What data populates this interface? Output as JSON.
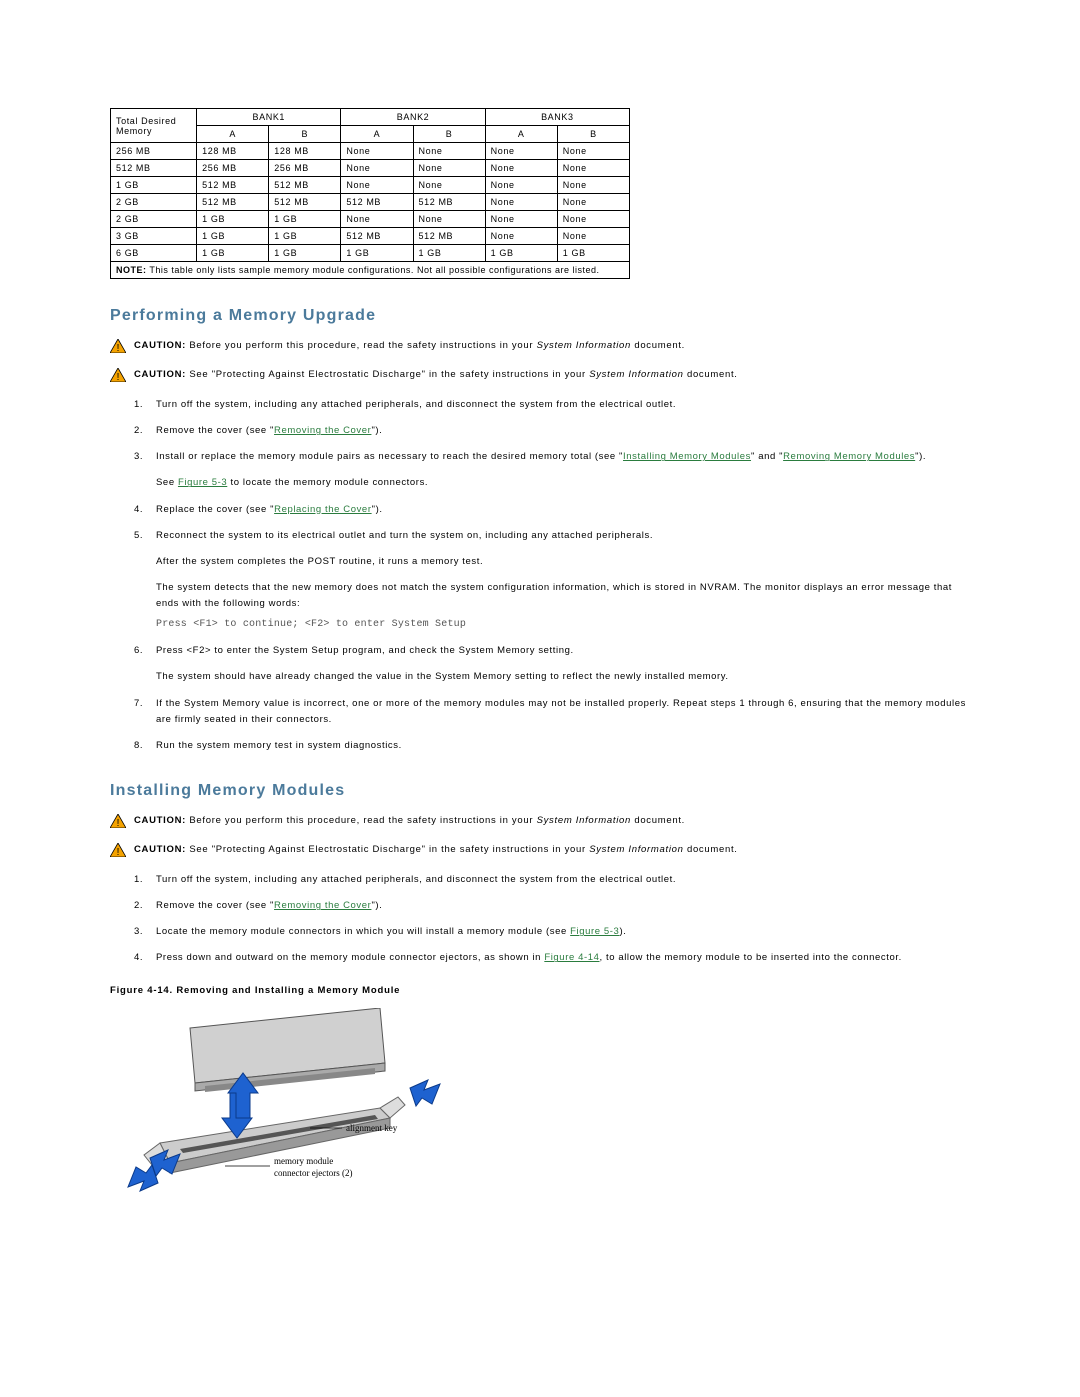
{
  "table": {
    "header_left": "Total Desired Memory",
    "banks": [
      "BANK1",
      "BANK2",
      "BANK3"
    ],
    "sub": [
      "A",
      "B",
      "A",
      "B",
      "A",
      "B"
    ],
    "rows": [
      {
        "label": "256 MB",
        "cells": [
          "128 MB",
          "128 MB",
          "None",
          "None",
          "None",
          "None"
        ]
      },
      {
        "label": "512 MB",
        "cells": [
          "256 MB",
          "256 MB",
          "None",
          "None",
          "None",
          "None"
        ]
      },
      {
        "label": "1 GB",
        "cells": [
          "512 MB",
          "512 MB",
          "None",
          "None",
          "None",
          "None"
        ]
      },
      {
        "label": "2 GB",
        "cells": [
          "512 MB",
          "512 MB",
          "512 MB",
          "512 MB",
          "None",
          "None"
        ]
      },
      {
        "label": "2 GB",
        "cells": [
          "1 GB",
          "1 GB",
          "None",
          "None",
          "None",
          "None"
        ]
      },
      {
        "label": "3 GB",
        "cells": [
          "1 GB",
          "1 GB",
          "512 MB",
          "512 MB",
          "None",
          "None"
        ]
      },
      {
        "label": "6 GB",
        "cells": [
          "1 GB",
          "1 GB",
          "1 GB",
          "1 GB",
          "1 GB",
          "1 GB"
        ]
      }
    ],
    "note_label": "NOTE:",
    "note_text": " This table only lists sample memory module configurations. Not all possible configurations are listed."
  },
  "sections": {
    "upgrade_title": "Performing a Memory Upgrade",
    "install_title": "Installing Memory Modules"
  },
  "caution": {
    "label": "CAUTION: ",
    "c1_pre": "Before you perform this procedure, read the safety instructions in your ",
    "c1_ital": "System Information",
    "c1_post": " document.",
    "c2_pre": "See \"Protecting Against Electrostatic Discharge\" in the safety instructions in your ",
    "c2_ital": "System Information",
    "c2_post": " document."
  },
  "upgrade_steps": {
    "s1": "Turn off the system, including any attached peripherals, and disconnect the system from the electrical outlet.",
    "s2_pre": "Remove the cover (see \"",
    "s2_link": "Removing the Cover",
    "s2_post": "\").",
    "s3_pre": "Install or replace the memory module pairs as necessary to reach the desired memory total (see \"",
    "s3_link1": "Installing Memory Modules",
    "s3_mid": "\" and \"",
    "s3_link2": "Removing Memory Modules",
    "s3_post": "\").",
    "s3_b_pre": "See ",
    "s3_b_link": "Figure 5-3",
    "s3_b_post": " to locate the memory module connectors.",
    "s4_pre": "Replace the cover (see \"",
    "s4_link": "Replacing the Cover",
    "s4_post": "\").",
    "s5": "Reconnect the system to its electrical outlet and turn the system on, including any attached peripherals.",
    "s5_b": "After the system completes the POST routine, it runs a memory test.",
    "s5_c": "The system detects that the new memory does not match the system configuration information, which is stored in NVRAM. The monitor displays an error message that ends with the following words:",
    "code": "Press <F1> to continue; <F2> to enter System Setup",
    "s6": "Press <F2> to enter the System Setup program, and check the System Memory setting.",
    "s6_b": "The system should have already changed the value in the System Memory setting to reflect the newly installed memory.",
    "s7": "If the System Memory value is incorrect, one or more of the memory modules may not be installed properly. Repeat steps 1 through 6, ensuring that the memory modules are firmly seated in their connectors.",
    "s8": "Run the system memory test in system diagnostics."
  },
  "install_steps": {
    "s1": "Turn off the system, including any attached peripherals, and disconnect the system from the electrical outlet.",
    "s2_pre": "Remove the cover (see \"",
    "s2_link": "Removing the Cover",
    "s2_post": "\").",
    "s3_pre": "Locate the memory module connectors in which you will install a memory module (see ",
    "s3_link": "Figure 5-3",
    "s3_post": ").",
    "s4_pre": "Press down and outward on the memory module connector ejectors, as shown in ",
    "s4_link": "Figure 4-14",
    "s4_post": ", to allow the memory module to be inserted into the connector."
  },
  "figure": {
    "caption": "Figure 4-14. Removing and Installing a Memory Module",
    "label_align": "alignment key",
    "label_eject1": "memory module",
    "label_eject2": "connector ejectors (2)"
  }
}
